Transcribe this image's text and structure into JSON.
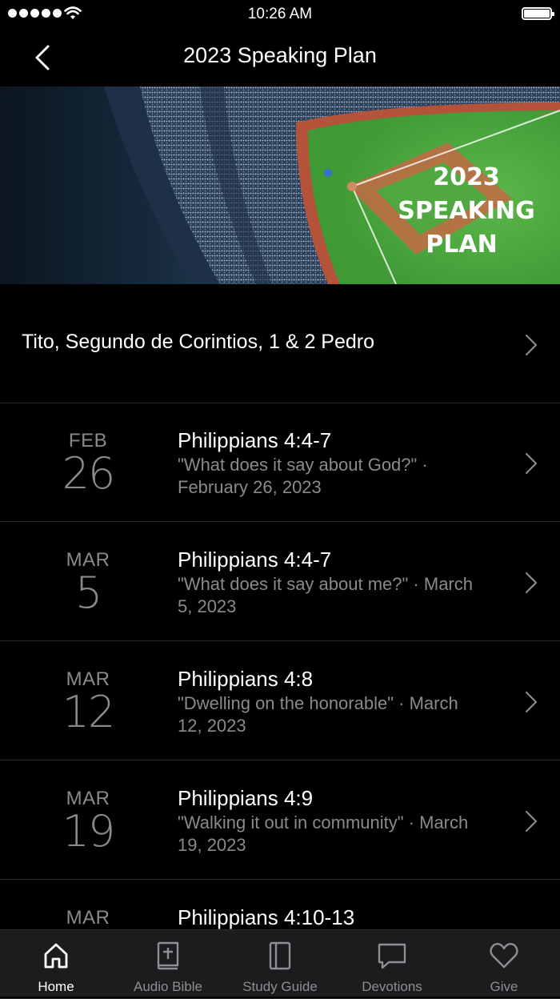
{
  "status_bar": {
    "time": "10:26 AM"
  },
  "nav": {
    "title": "2023 Speaking Plan"
  },
  "banner": {
    "line1": "2023",
    "line2": "SPEAKING",
    "line3": "PLAN"
  },
  "plan": {
    "title": "Tito, Segundo de Corintios, 1 & 2 Pedro"
  },
  "sessions": [
    {
      "month": "FEB",
      "day": "26",
      "title": "Philippians 4:4-7",
      "sub1": "\"What does it say about God?\" ·",
      "sub2": "February 26, 2023"
    },
    {
      "month": "MAR",
      "day": "5",
      "title": "Philippians 4:4-7",
      "sub1": "\"What does it say about me?\" · March",
      "sub2": "5, 2023"
    },
    {
      "month": "MAR",
      "day": "12",
      "title": "Philippians 4:8",
      "sub1": "\"Dwelling on the honorable\" · March",
      "sub2": "12, 2023"
    },
    {
      "month": "MAR",
      "day": "19",
      "title": "Philippians 4:9",
      "sub1": "\"Walking it out in community\" · March",
      "sub2": "19, 2023"
    },
    {
      "month": "MAR",
      "day": "",
      "title": "Philippians 4:10-13",
      "sub1": "",
      "sub2": ""
    }
  ],
  "tabs": [
    {
      "label": "Home",
      "icon": "home-icon",
      "active": true
    },
    {
      "label": "Audio Bible",
      "icon": "bible-icon",
      "active": false
    },
    {
      "label": "Study Guide",
      "icon": "book-icon",
      "active": false
    },
    {
      "label": "Devotions",
      "icon": "chat-bubble-icon",
      "active": false
    },
    {
      "label": "Give",
      "icon": "heart-icon",
      "active": false
    }
  ]
}
